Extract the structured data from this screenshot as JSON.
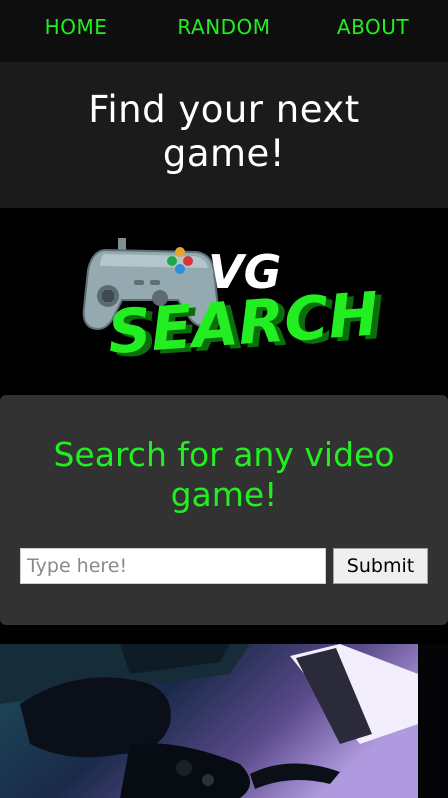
{
  "nav": {
    "items": [
      {
        "label": "HOME"
      },
      {
        "label": "RANDOM"
      },
      {
        "label": "ABOUT"
      }
    ]
  },
  "hero": {
    "title_line1": "Find your next",
    "title_line2": "game!"
  },
  "logo": {
    "text_top": "VG",
    "text_main": "SEARCH"
  },
  "search": {
    "heading_line1": "Search for any video",
    "heading_line2": "game!",
    "placeholder": "Type here!",
    "value": "",
    "submit_label": "Submit"
  },
  "colors": {
    "accent": "#22ee22",
    "nav_bg": "#0e0e0e",
    "hero_bg": "#1b1b1b",
    "card_bg": "#323232"
  }
}
